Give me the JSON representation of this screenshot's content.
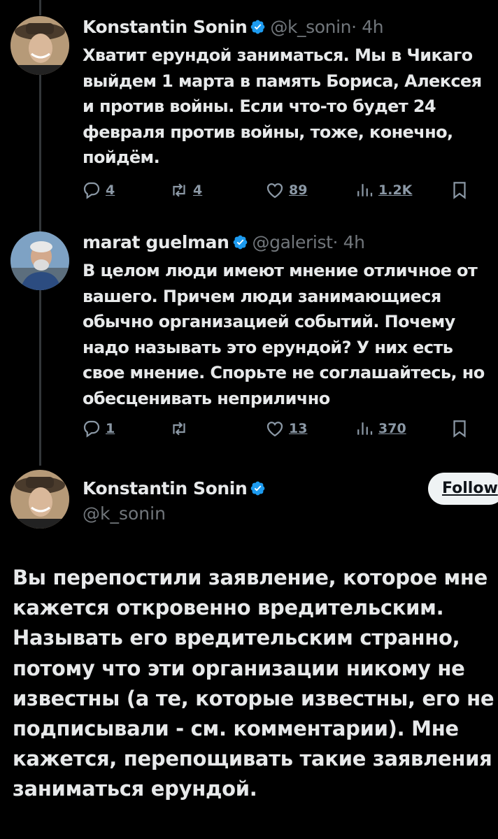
{
  "tweets": [
    {
      "author_name": "Konstantin Sonin",
      "handle": "@k_sonin",
      "meta": "· 4h",
      "lines": [
        "Хватит ерундой заниматься. Мы в Чикаго",
        "выйдем 1 марта в память Бориса, Алексея",
        "и против войны. Если что-то будет 24",
        "февраля против войны, тоже, конечно,",
        "пойдём."
      ],
      "replies": "4",
      "reposts": "4",
      "likes": "89",
      "views": "1.2K"
    },
    {
      "author_name": "marat guelman",
      "handle": "@galerist",
      "meta": "· 4h",
      "lines": [
        "В целом люди имеют мнение отличное от",
        "вашего. Причем люди занимающиеся",
        "обычно организацией событий. Почему",
        "надо называть это ерундой? У них есть",
        "свое мнение. Спорьте не соглашайтесь, но",
        "обесценивать неприлично"
      ],
      "replies": "1",
      "reposts": "",
      "likes": "13",
      "views": "370"
    }
  ],
  "main_post": {
    "author_name": "Konstantin Sonin",
    "handle": "@k_sonin",
    "follow_label": "Follow",
    "lines": [
      "Вы перепостили заявление, которое мне",
      "кажется откровенно вредительским.",
      "Называть его вредительским странно,",
      "потому что эти организации никому не",
      "известны (а те, которые известны, его не",
      "подписывали - см. комментарии). Мне",
      "кажется, перепощивать такие заявления -",
      "заниматься ерундой."
    ]
  },
  "icons": {
    "verified": "verified-badge-icon",
    "reply": "reply-icon",
    "repost": "repost-icon",
    "like": "heart-icon",
    "views": "views-icon",
    "bookmark": "bookmark-icon"
  },
  "colors": {
    "background": "#000000",
    "text": "#e7e9ea",
    "muted": "#71767b",
    "verified": "#1d9bf0",
    "follow_bg": "#eff3f4"
  }
}
